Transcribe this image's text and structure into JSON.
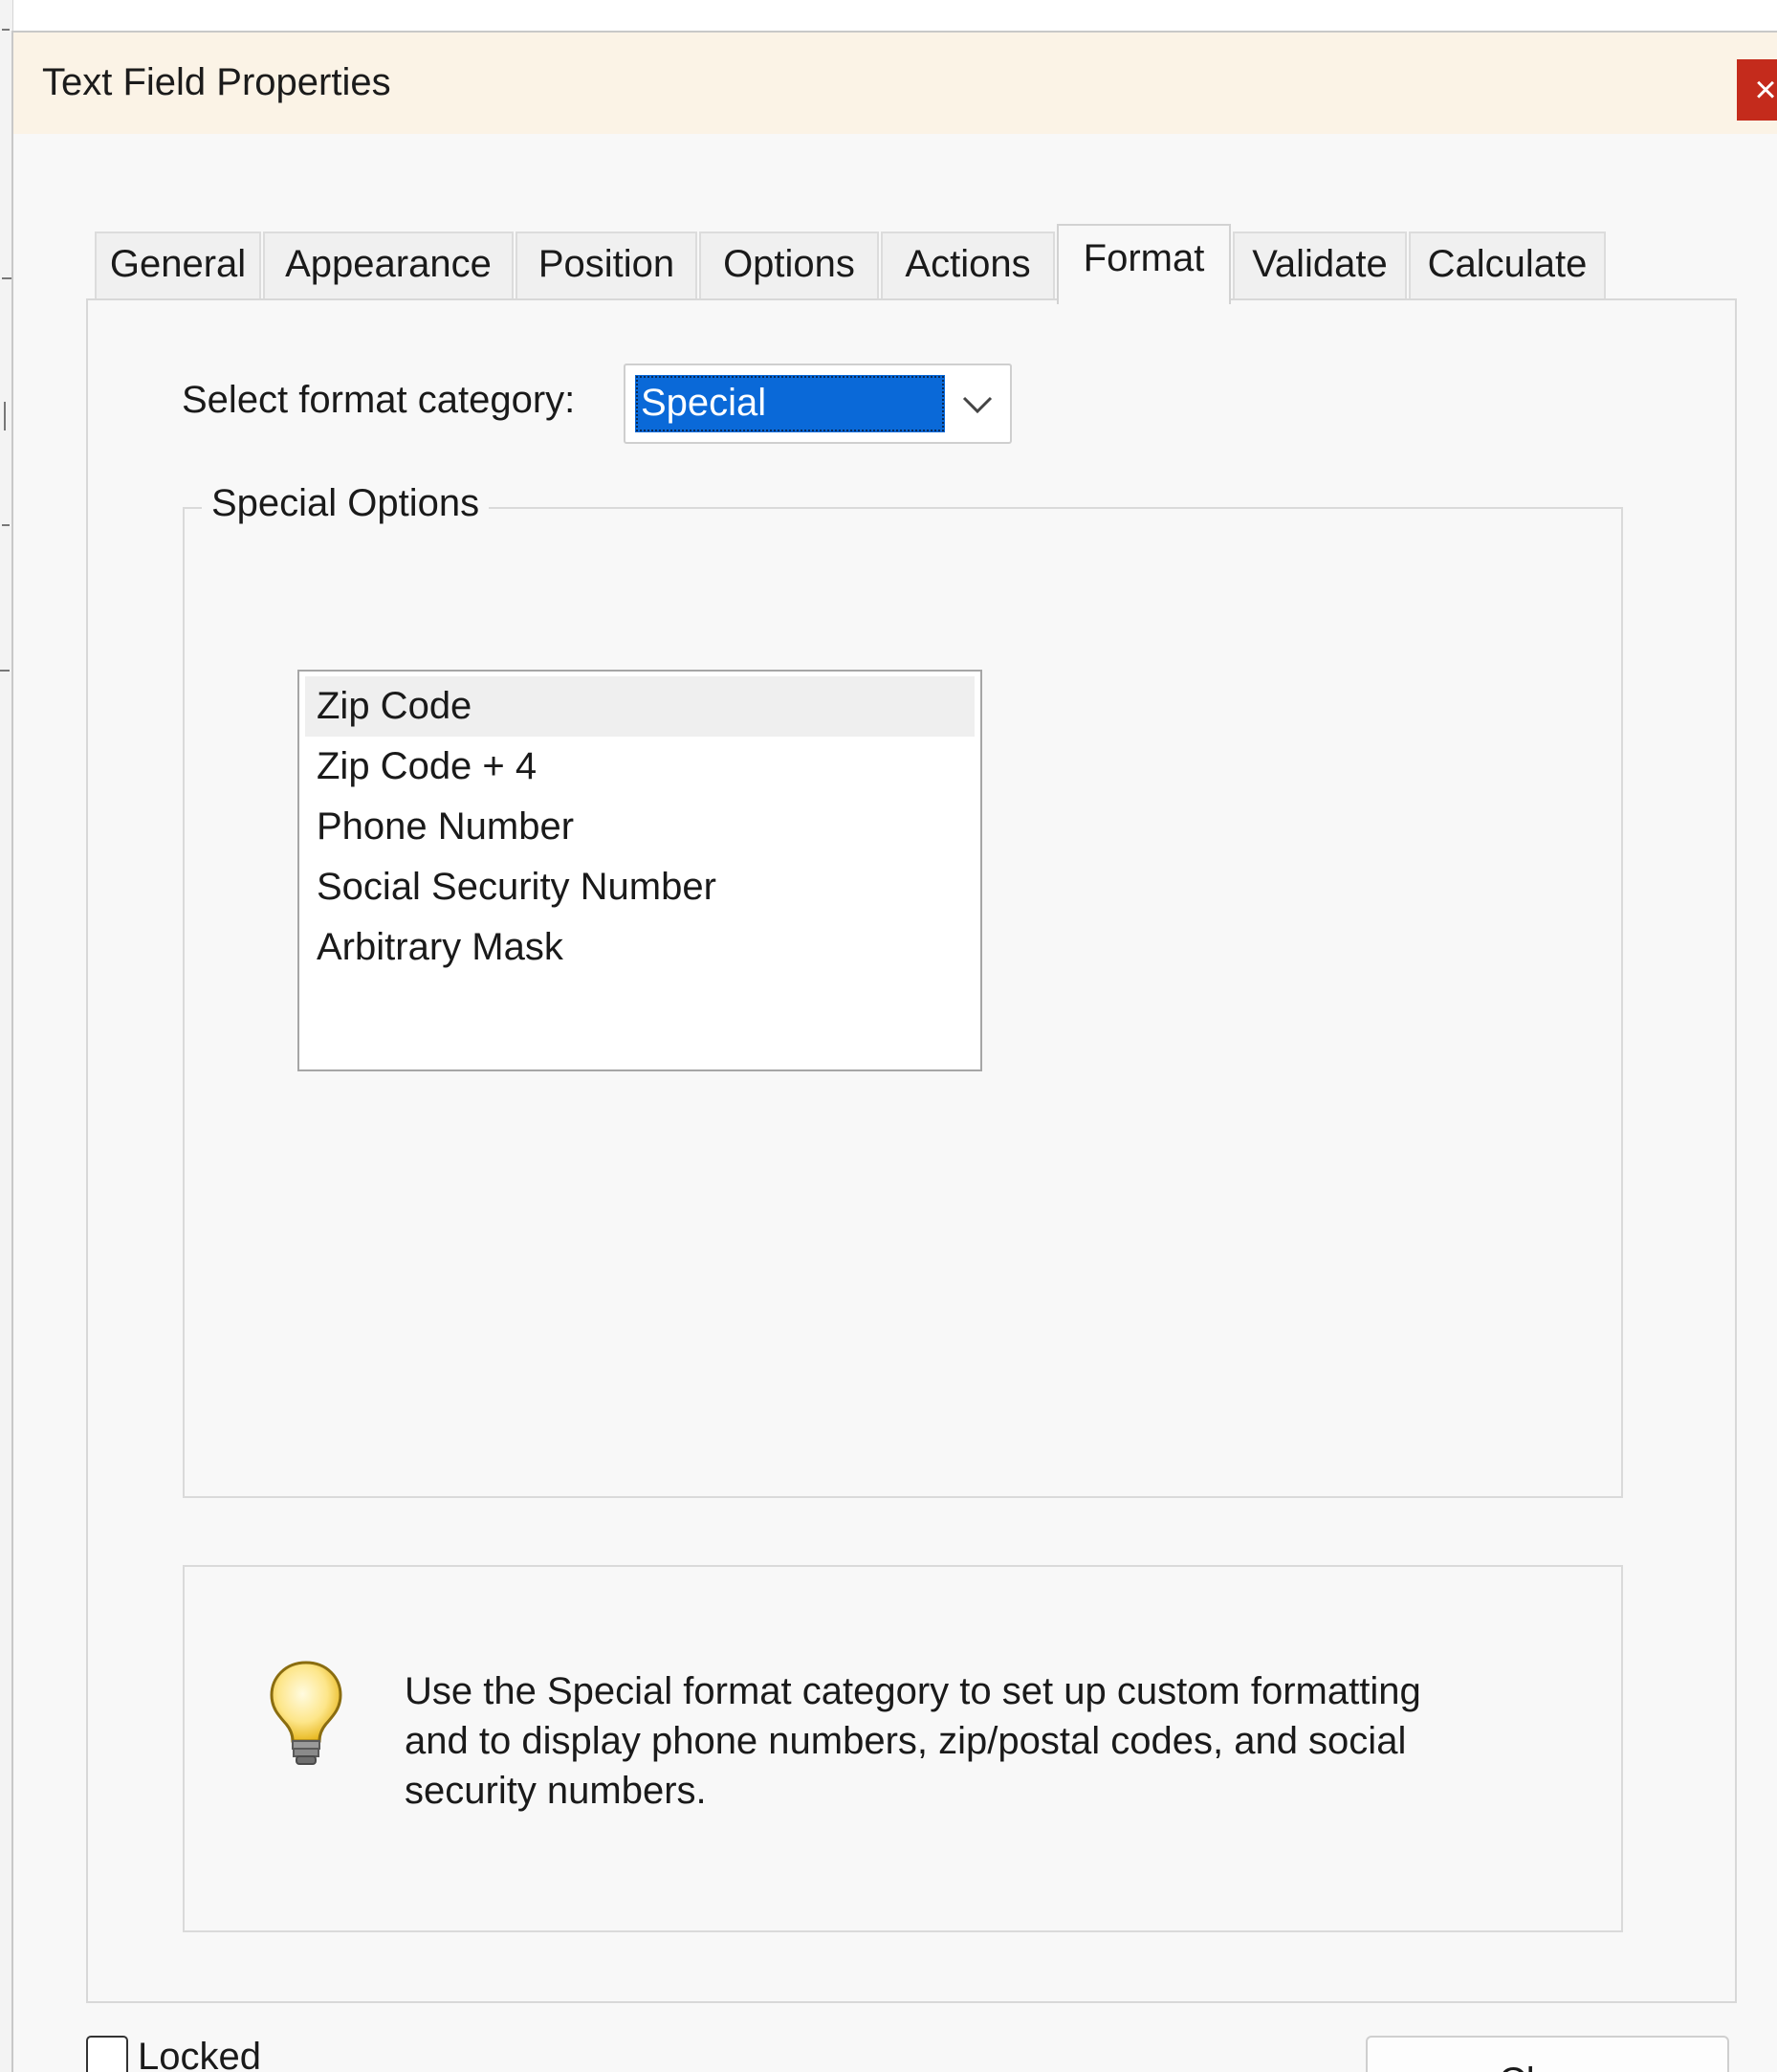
{
  "window": {
    "title": "Text Field Properties",
    "close_glyph": "×"
  },
  "tabs": [
    {
      "label": "General"
    },
    {
      "label": "Appearance"
    },
    {
      "label": "Position"
    },
    {
      "label": "Options"
    },
    {
      "label": "Actions"
    },
    {
      "label": "Format",
      "active": true
    },
    {
      "label": "Validate"
    },
    {
      "label": "Calculate"
    }
  ],
  "format": {
    "category_label": "Select format category:",
    "category_value": "Special",
    "group_title": "Special Options",
    "special_options": [
      {
        "label": "Zip Code",
        "selected": true
      },
      {
        "label": "Zip Code + 4"
      },
      {
        "label": "Phone Number"
      },
      {
        "label": "Social Security Number"
      },
      {
        "label": "Arbitrary Mask"
      }
    ],
    "info_text": "Use the Special format category to set up custom formatting and to display phone numbers, zip/postal codes, and social security numbers."
  },
  "footer": {
    "locked_label": "Locked",
    "locked_checked": false,
    "close_label": "Close"
  },
  "icons": {
    "bulb": "lightbulb-icon",
    "chevron": "chevron-down-icon"
  },
  "colors": {
    "titlebar": "#fbf3e6",
    "selection": "#0a69d8",
    "close_red": "#c42b1c",
    "panel": "#f8f8f8"
  }
}
